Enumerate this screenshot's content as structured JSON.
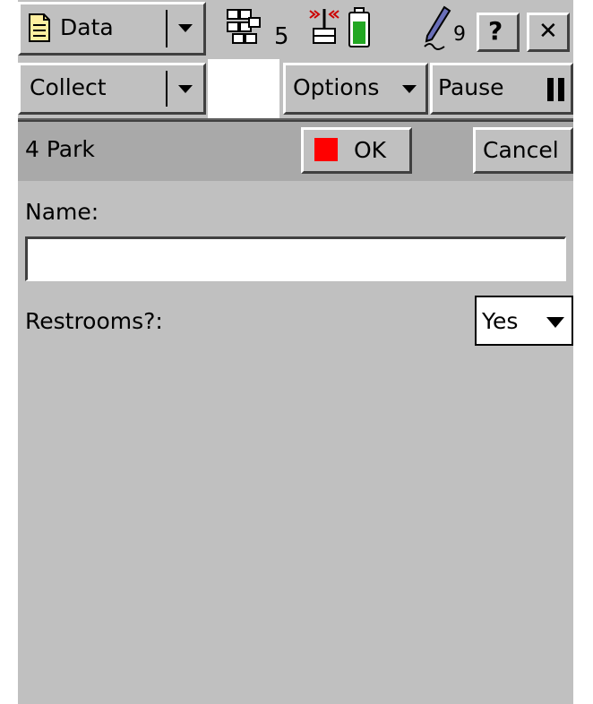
{
  "titlebar": {
    "data_label": "Data",
    "satellite_count": "5",
    "pen_count": "9",
    "help_label": "?",
    "close_label": "✕"
  },
  "toolbar": {
    "collect_label": "Collect",
    "options_label": "Options",
    "pause_label": "Pause"
  },
  "form": {
    "title": "4 Park",
    "ok_label": "OK",
    "cancel_label": "Cancel",
    "ok_indicator_color": "#ff0000"
  },
  "fields": {
    "name_label": "Name:",
    "name_value": "",
    "restrooms_label": "Restrooms?:",
    "restrooms_value": "Yes"
  },
  "colors": {
    "background": "#c0c0c0",
    "header_band": "#a9a9a9",
    "battery": "#22a722",
    "signal": "#cc0000"
  }
}
